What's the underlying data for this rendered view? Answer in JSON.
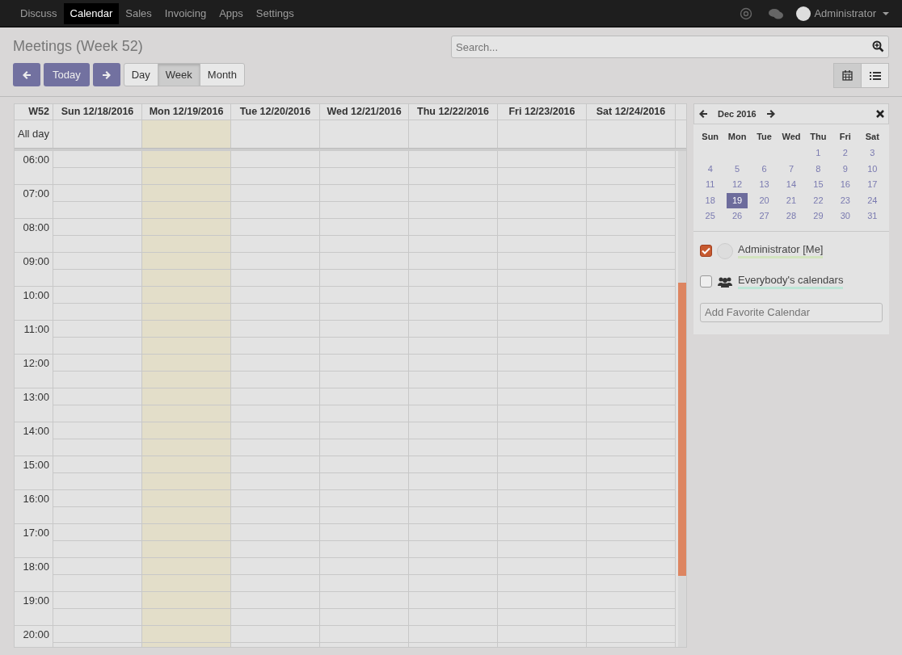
{
  "navbar": {
    "menu": [
      {
        "label": "Discuss",
        "selected": false
      },
      {
        "label": "Calendar",
        "selected": true
      },
      {
        "label": "Sales",
        "selected": false
      },
      {
        "label": "Invoicing",
        "selected": false
      },
      {
        "label": "Apps",
        "selected": false
      },
      {
        "label": "Settings",
        "selected": false
      }
    ],
    "user": "Administrator"
  },
  "title": "Meetings (Week 52)",
  "search": {
    "placeholder": "Search..."
  },
  "nav_buttons": {
    "today": "Today"
  },
  "scale_tabs": [
    {
      "label": "Day",
      "selected": false
    },
    {
      "label": "Week",
      "selected": true
    },
    {
      "label": "Month",
      "selected": false
    }
  ],
  "view_switch": [
    {
      "kind": "calendar",
      "selected": true
    },
    {
      "kind": "list",
      "selected": false
    }
  ],
  "week": {
    "label": "W52",
    "all_day": "All day",
    "days": [
      {
        "label": "Sun 12/18/2016",
        "today": false
      },
      {
        "label": "Mon 12/19/2016",
        "today": true
      },
      {
        "label": "Tue 12/20/2016",
        "today": false
      },
      {
        "label": "Wed 12/21/2016",
        "today": false
      },
      {
        "label": "Thu 12/22/2016",
        "today": false
      },
      {
        "label": "Fri 12/23/2016",
        "today": false
      },
      {
        "label": "Sat 12/24/2016",
        "today": false
      }
    ],
    "hours": [
      "06:00",
      "07:00",
      "08:00",
      "09:00",
      "10:00",
      "11:00",
      "12:00",
      "13:00",
      "14:00",
      "15:00",
      "16:00",
      "17:00",
      "18:00",
      "19:00",
      "20:00"
    ]
  },
  "mini_calendar": {
    "month": "Dec 2016",
    "weekdays": [
      "Sun",
      "Mon",
      "Tue",
      "Wed",
      "Thu",
      "Fri",
      "Sat"
    ],
    "weeks": [
      [
        {
          "label": "1",
          "selected": false
        },
        {
          "label": "2",
          "selected": false
        },
        {
          "label": "3",
          "selected": false
        }
      ],
      [
        {
          "label": "4",
          "selected": false
        },
        {
          "label": "5",
          "selected": false
        },
        {
          "label": "6",
          "selected": false
        },
        {
          "label": "7",
          "selected": false
        },
        {
          "label": "8",
          "selected": false
        },
        {
          "label": "9",
          "selected": false
        },
        {
          "label": "10",
          "selected": false
        }
      ],
      [
        {
          "label": "11",
          "selected": false
        },
        {
          "label": "12",
          "selected": false
        },
        {
          "label": "13",
          "selected": false
        },
        {
          "label": "14",
          "selected": false
        },
        {
          "label": "15",
          "selected": false
        },
        {
          "label": "16",
          "selected": false
        },
        {
          "label": "17",
          "selected": false
        }
      ],
      [
        {
          "label": "18",
          "selected": false
        },
        {
          "label": "19",
          "selected": true
        },
        {
          "label": "20",
          "selected": false
        },
        {
          "label": "21",
          "selected": false
        },
        {
          "label": "22",
          "selected": false
        },
        {
          "label": "23",
          "selected": false
        },
        {
          "label": "24",
          "selected": false
        }
      ],
      [
        {
          "label": "25",
          "selected": false
        },
        {
          "label": "26",
          "selected": false
        },
        {
          "label": "27",
          "selected": false
        },
        {
          "label": "28",
          "selected": false
        },
        {
          "label": "29",
          "selected": false
        },
        {
          "label": "30",
          "selected": false
        },
        {
          "label": "31",
          "selected": false
        }
      ]
    ]
  },
  "calendar_filters": [
    {
      "kind": "person",
      "label": "Administrator [Me]",
      "checked": true,
      "color": "#d3e4bf"
    },
    {
      "kind": "group",
      "label": "Everybody's calendars",
      "checked": false,
      "color": "#bde5d6"
    }
  ],
  "favorite": {
    "placeholder": "Add Favorite Calendar"
  }
}
